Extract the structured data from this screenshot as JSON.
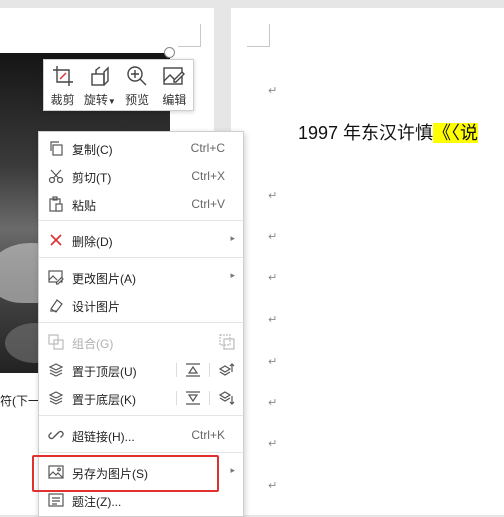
{
  "toolbar": {
    "crop": "裁剪",
    "rotate": "旋转",
    "preview": "预览",
    "edit": "编辑"
  },
  "caption_fragment": "符(下一",
  "menu": {
    "copy": {
      "label": "复制(C)",
      "shortcut": "Ctrl+C"
    },
    "cut": {
      "label": "剪切(T)",
      "shortcut": "Ctrl+X"
    },
    "paste": {
      "label": "粘贴",
      "shortcut": "Ctrl+V"
    },
    "delete": {
      "label": "删除(D)"
    },
    "change_picture": {
      "label": "更改图片(A)"
    },
    "design_picture": {
      "label": "设计图片"
    },
    "group": {
      "label": "组合(G)"
    },
    "bring_to_front": {
      "label": "置于顶层(U)"
    },
    "send_to_back": {
      "label": "置于底层(K)"
    },
    "hyperlink": {
      "label": "超链接(H)...",
      "shortcut": "Ctrl+K"
    },
    "save_as_picture": {
      "label": "另存为图片(S)"
    },
    "caption": {
      "label": "题注(Z)..."
    }
  },
  "document": {
    "line_prefix": "1997 年东汉许慎",
    "line_highlight": "《〈说"
  },
  "colors": {
    "highlight_border": "#e0302f",
    "text_highlight": "#ffff00",
    "icon_blue": "#2f6fd8"
  }
}
